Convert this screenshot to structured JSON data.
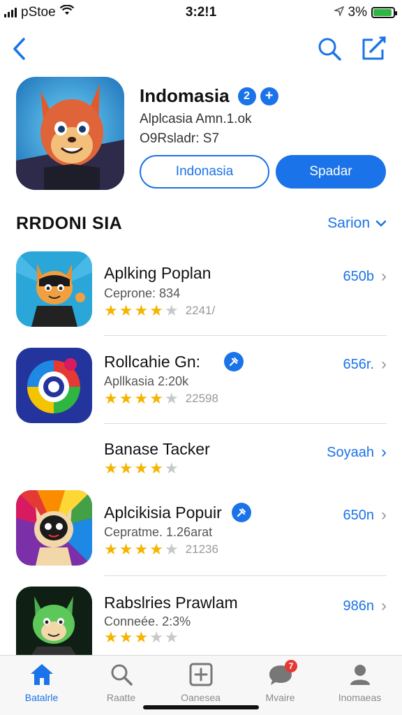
{
  "status_bar": {
    "carrier": "pStoe",
    "time": "3:2!1",
    "battery": "3%"
  },
  "nav": {
    "back_icon": "chevron-left-icon",
    "search_icon": "search-icon",
    "compose_icon": "compose-icon"
  },
  "hero": {
    "title": "Indomasia",
    "badge_count": "2",
    "badge_plus": "+",
    "subtitle1": "Alplcasia Amn.1.ok",
    "subtitle2": "O9Rsladr: S7",
    "button_outline": "Indonasia",
    "button_primary": "Spadar"
  },
  "section": {
    "title": "RRDONI SIA",
    "link": "Sarion"
  },
  "apps": [
    {
      "name": "Aplking Poplan",
      "subtitle": "Ceprone: 834",
      "stars": 4.5,
      "rating_count": "2241/",
      "action": "650b",
      "has_badge": false
    },
    {
      "name": "Rollcahie Gn:",
      "subtitle": "Apllkasia 2:20k",
      "stars": 4,
      "rating_count": "22598",
      "action": "656r.",
      "has_badge": true
    },
    {
      "name": "Banase Tacker",
      "subtitle": "",
      "stars": 4,
      "rating_count": "",
      "action": "Soyaah",
      "has_badge": false
    },
    {
      "name": "Aplcikisia Popuir",
      "subtitle": "Cepratme. 1.26arat",
      "stars": 4,
      "rating_count": "21236",
      "action": "650n",
      "has_badge": true
    },
    {
      "name": "Rabslries Prawlam",
      "subtitle": "Conneée. 2:3%",
      "stars": 3.5,
      "rating_count": "",
      "action": "986n",
      "has_badge": false
    }
  ],
  "tabs": [
    {
      "label": "Batalrle",
      "icon": "home-icon",
      "active": true
    },
    {
      "label": "Raatte",
      "icon": "search-icon",
      "active": false
    },
    {
      "label": "Oanesea",
      "icon": "add-square-icon",
      "active": false
    },
    {
      "label": "Mvaire",
      "icon": "chat-bubble-icon",
      "active": false,
      "badge": "7"
    },
    {
      "label": "Inomaeas",
      "icon": "profile-icon",
      "active": false
    }
  ],
  "colors": {
    "accent": "#1a73e8",
    "star": "#f5b400",
    "badge_red": "#e53935"
  }
}
